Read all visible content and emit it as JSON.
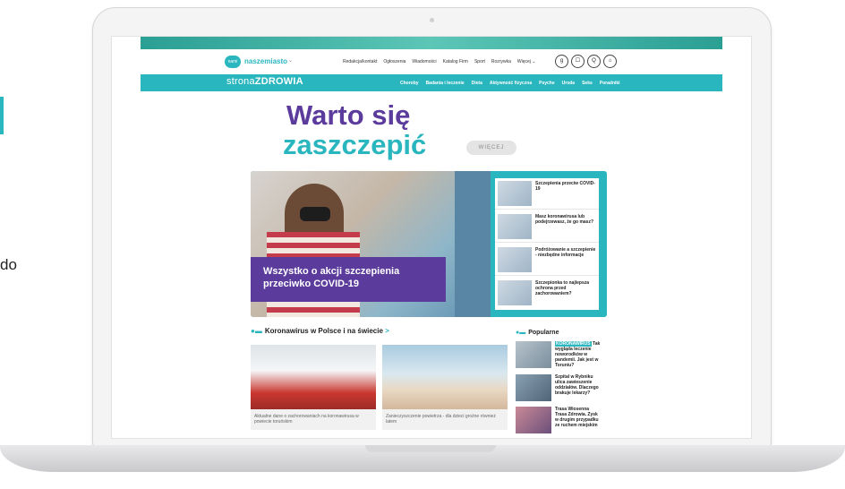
{
  "side": {
    "text": "do"
  },
  "site": {
    "logo_badge": "nami",
    "logo_text": "naszemiasto",
    "logo_dropdown": "⌄",
    "nav_links": [
      "Redakcja/kontakt",
      "Ogłoszenia",
      "Wiadomości",
      "Katalog Firm",
      "Sport",
      "Rozrywka",
      "Więcej ⌄"
    ],
    "nav_icons": [
      "g",
      "☐",
      "Q",
      "⌂"
    ],
    "brand_prefix": "strona",
    "brand_suffix": "ZDROWIA",
    "categories": [
      "Choroby",
      "Badania i leczenie",
      "Dieta",
      "Aktywność fizyczna",
      "Psyche",
      "Uroda",
      "Seks",
      "Poradniki"
    ]
  },
  "promo": {
    "line1": "Warto się",
    "line2": "zaszczepić",
    "button": "WIĘCEJ"
  },
  "feature": {
    "caption": "Wszystko o akcji szczepienia przeciwko COVID-19",
    "side_items": [
      "Szczepienia przeciw COVID-19",
      "Masz koronawirusa lub podejrzewasz, że go masz?",
      "Podróżowanie a szczepienie - niezbędne informacje",
      "Szczepionka to najlepsza ochrona przed zachorowaniem?"
    ]
  },
  "section": {
    "title": "Koronawirus w Polsce i na świecie",
    "chevron": ">",
    "dots": "●▬",
    "cards": [
      {
        "text": "Aktualne dane o zachorowaniach na koronawirusa w powiecie toruńskim"
      },
      {
        "text": "Zanieczyszczenie powietrza - dla dzieci groźne również latem"
      }
    ]
  },
  "popular": {
    "title": "Popularne",
    "dots": "●▬",
    "items": [
      {
        "badge": "KORONAWIRUS",
        "text": "Tak wygląda leczenie noworodków w pandemii. Jak jest w Toruniu?"
      },
      {
        "badge": "",
        "text": "Szpital w Rybniku ulica zawieszenie oddziałów. Dlaczego brakuje lekarzy?"
      },
      {
        "badge": "",
        "text": "Trasa Wiosenna Trasa Zdrowia. Zysk w drugim przypadku ze ruchem miejskim"
      }
    ]
  },
  "colors": {
    "accent": "#2ab6be",
    "brand_purple": "#5b3b9c"
  }
}
